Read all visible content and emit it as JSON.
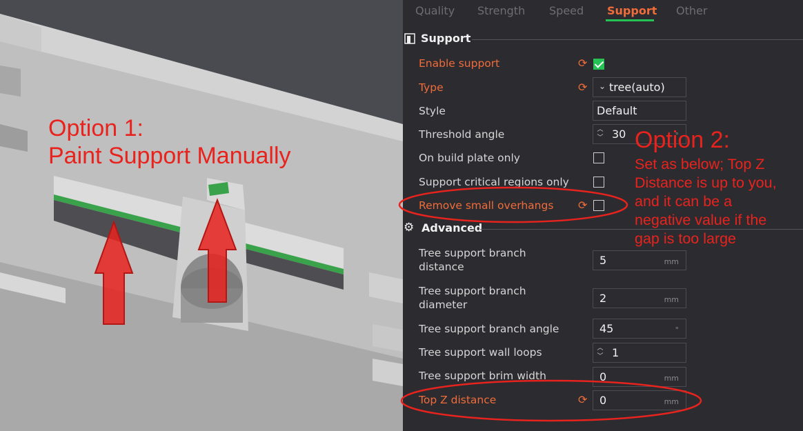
{
  "tabs": [
    {
      "label": "Quality"
    },
    {
      "label": "Strength"
    },
    {
      "label": "Speed"
    },
    {
      "label": "Support"
    },
    {
      "label": "Other"
    }
  ],
  "sections": {
    "support_title": "Support",
    "advanced_title": "Advanced"
  },
  "settings": {
    "enable_support": {
      "label": "Enable support",
      "checked": true
    },
    "type": {
      "label": "Type",
      "value": "tree(auto)"
    },
    "style": {
      "label": "Style",
      "value": "Default"
    },
    "threshold_angle": {
      "label": "Threshold angle",
      "value": "30",
      "unit": "°"
    },
    "build_plate_only": {
      "label": "On build plate only",
      "checked": false
    },
    "critical_regions_only": {
      "label": "Support critical regions only",
      "checked": false
    },
    "remove_small_overhangs": {
      "label": "Remove small overhangs",
      "checked": false
    },
    "branch_distance": {
      "label_line1": "Tree support branch",
      "label_line2": "distance",
      "value": "5",
      "unit": "mm"
    },
    "branch_diameter": {
      "label_line1": "Tree support branch",
      "label_line2": "diameter",
      "value": "2",
      "unit": "mm"
    },
    "branch_angle": {
      "label": "Tree support branch angle",
      "value": "45",
      "unit": "°"
    },
    "wall_loops": {
      "label": "Tree support wall loops",
      "value": "1"
    },
    "brim_width": {
      "label": "Tree support brim width",
      "value": "0",
      "unit": "mm"
    },
    "top_z_distance": {
      "label": "Top Z distance",
      "value": "0",
      "unit": "mm"
    }
  },
  "annotations": {
    "option1_line1": "Option 1:",
    "option1_line2": "Paint Support Manually",
    "option2_title": "Option 2:",
    "option2_line1": "Set as below; Top Z",
    "option2_line2": "Distance is up to you,",
    "option2_line3": "and it can be a",
    "option2_line4": "negative value if the",
    "option2_line5": "gap is too large"
  },
  "colors": {
    "accent_orange": "#f06c3a",
    "accent_green": "#27c256",
    "annotation_red": "#e8231e",
    "panel_bg": "#2c2c30"
  }
}
